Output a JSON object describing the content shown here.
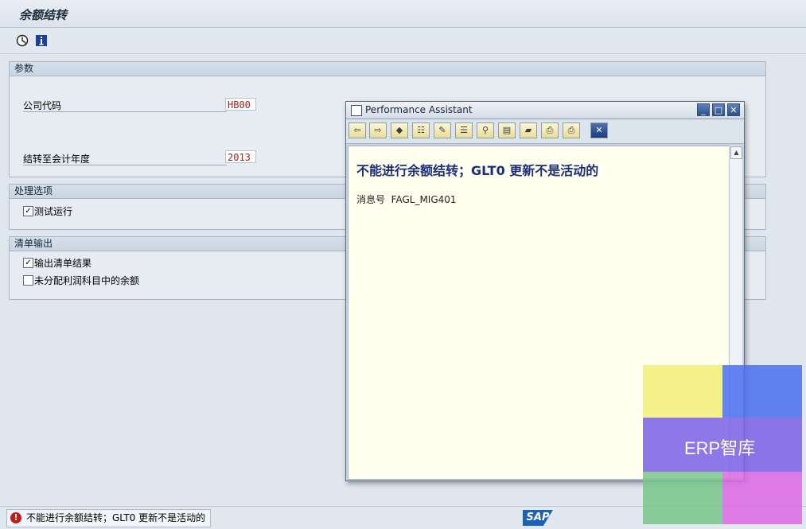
{
  "window": {
    "title": "余额结转"
  },
  "app_toolbar": {
    "icons": [
      "execute-icon",
      "info-icon"
    ]
  },
  "groups": {
    "params": {
      "title": "参数",
      "company_code_label": "公司代码",
      "company_code_value": "HB00",
      "fiscal_year_label": "结转至会计年度",
      "fiscal_year_value": "2013"
    },
    "processing": {
      "title": "处理选项",
      "test_run_label": "测试运行",
      "test_run_checked": true
    },
    "list_output": {
      "title": "清单输出",
      "output_list_label": "输出清单结果",
      "output_list_checked": true,
      "undistributed_label": "未分配利润科目中的余额",
      "undistributed_checked": false
    }
  },
  "popup": {
    "title": "Performance Assistant",
    "heading": "不能进行余额结转；GLT0 更新不是活动的",
    "message_no_label": "消息号",
    "message_no": "FAGL_MIG401",
    "toolbar_icons": [
      "back-icon",
      "forward-icon",
      "book-icon",
      "tree-icon",
      "edit-icon",
      "technical-info-icon",
      "search-icon",
      "table-icon",
      "note-icon",
      "print-preview-icon",
      "print-icon",
      "close-icon"
    ]
  },
  "status_bar": {
    "message": "不能进行余额结转；GLT0 更新不是活动的",
    "logo": "SAP"
  },
  "watermark": {
    "text": "ERP智库",
    "colors": [
      "#f2ee78",
      "#4a6ff0",
      "#7a60e6",
      "#78c689",
      "#de67e2"
    ]
  }
}
